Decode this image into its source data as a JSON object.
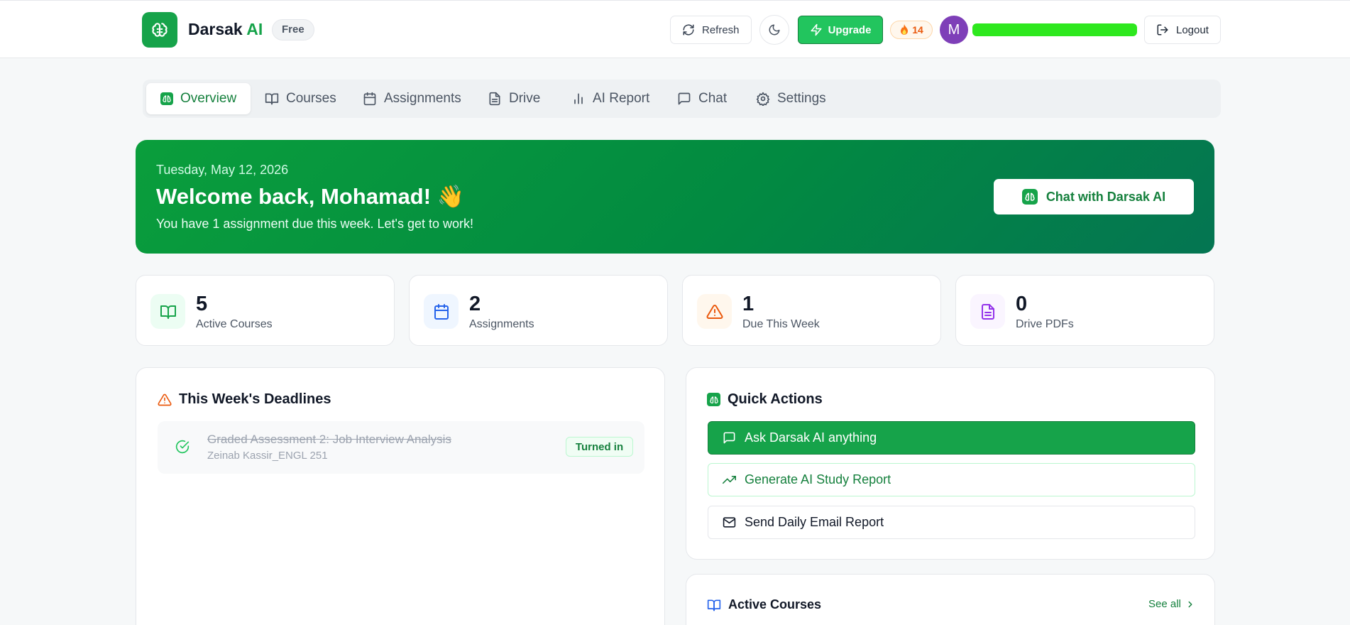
{
  "header": {
    "brand_name": "Darsak",
    "brand_ai": "AI",
    "plan_badge": "Free",
    "refresh_label": "Refresh",
    "upgrade_label": "Upgrade",
    "streak_count": "14",
    "avatar_initial": "M",
    "logout_label": "Logout"
  },
  "tabs": [
    {
      "label": "Overview",
      "icon": "brain-icon",
      "active": true
    },
    {
      "label": "Courses",
      "icon": "book-icon"
    },
    {
      "label": "Assignments",
      "icon": "calendar-icon"
    },
    {
      "label": "Drive",
      "icon": "document-icon"
    },
    {
      "label": "AI Report",
      "icon": "bar-chart-icon"
    },
    {
      "label": "Chat",
      "icon": "chat-icon"
    },
    {
      "label": "Settings",
      "icon": "gear-icon"
    }
  ],
  "hero": {
    "date": "Tuesday, May 12, 2026",
    "title": "Welcome back, Mohamad! 👋",
    "subtitle": "You have 1 assignment due this week. Let's get to work!",
    "chat_button": "Chat with Darsak AI"
  },
  "stats": [
    {
      "value": "5",
      "label": "Active Courses",
      "icon": "book-icon",
      "color": "#16a34a"
    },
    {
      "value": "2",
      "label": "Assignments",
      "icon": "calendar-icon",
      "color": "#2563eb"
    },
    {
      "value": "1",
      "label": "Due This Week",
      "icon": "warning-icon",
      "color": "#ea580c"
    },
    {
      "value": "0",
      "label": "Drive PDFs",
      "icon": "document-icon",
      "color": "#9333ea"
    }
  ],
  "deadlines": {
    "title": "This Week's Deadlines",
    "items": [
      {
        "title": "Graded Assessment 2: Job Interview Analysis",
        "course": "Zeinab Kassir_ENGL 251",
        "status": "Turned in"
      }
    ]
  },
  "quick_actions": {
    "title": "Quick Actions",
    "items": [
      {
        "label": "Ask Darsak AI anything",
        "icon": "chat-icon"
      },
      {
        "label": "Generate AI Study Report",
        "icon": "trending-up-icon"
      },
      {
        "label": "Send Daily Email Report",
        "icon": "mail-icon"
      }
    ]
  },
  "active_courses": {
    "title": "Active Courses",
    "see_all": "See all"
  },
  "colors": {
    "brand_green": "#16a34a",
    "hero_gradient_start": "#0a9e3c",
    "hero_gradient_end": "#047552"
  }
}
